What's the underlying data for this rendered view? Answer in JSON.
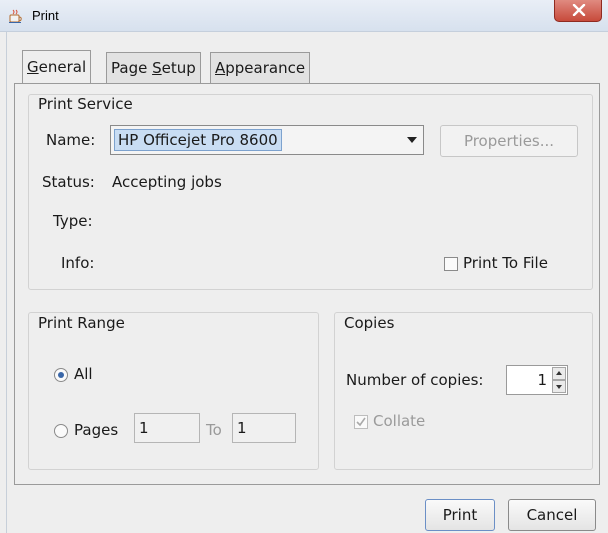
{
  "window": {
    "title": "Print",
    "close_glyph": "x",
    "app_icon": "java-cup-icon"
  },
  "tabs": [
    {
      "label": "General",
      "mnemonic_index": 0,
      "active": true
    },
    {
      "label": "Page Setup",
      "mnemonic_index": 5,
      "active": false
    },
    {
      "label": "Appearance",
      "mnemonic_index": 0,
      "active": false
    }
  ],
  "print_service": {
    "title": "Print Service",
    "name_label": "Name:",
    "name_value": "HP Officejet Pro 8600",
    "properties_label": "Properties...",
    "status_label": "Status:",
    "status_value": "Accepting jobs",
    "type_label": "Type:",
    "info_label": "Info:",
    "print_to_file_label": "Print To File",
    "print_to_file_checked": false
  },
  "print_range": {
    "title": "Print Range",
    "all_label": "All",
    "all_selected": true,
    "pages_label": "Pages",
    "pages_from": "1",
    "to_label": "To",
    "pages_to": "1"
  },
  "copies": {
    "title": "Copies",
    "number_label": "Number of copies:",
    "number_value": "1",
    "collate_label": "Collate",
    "collate_checked": true,
    "collate_enabled": false
  },
  "buttons": {
    "print": "Print",
    "cancel": "Cancel"
  },
  "colors": {
    "accent": "#3a67a8",
    "selection": "#c9ddf3",
    "close_button": "#c74a3b"
  }
}
